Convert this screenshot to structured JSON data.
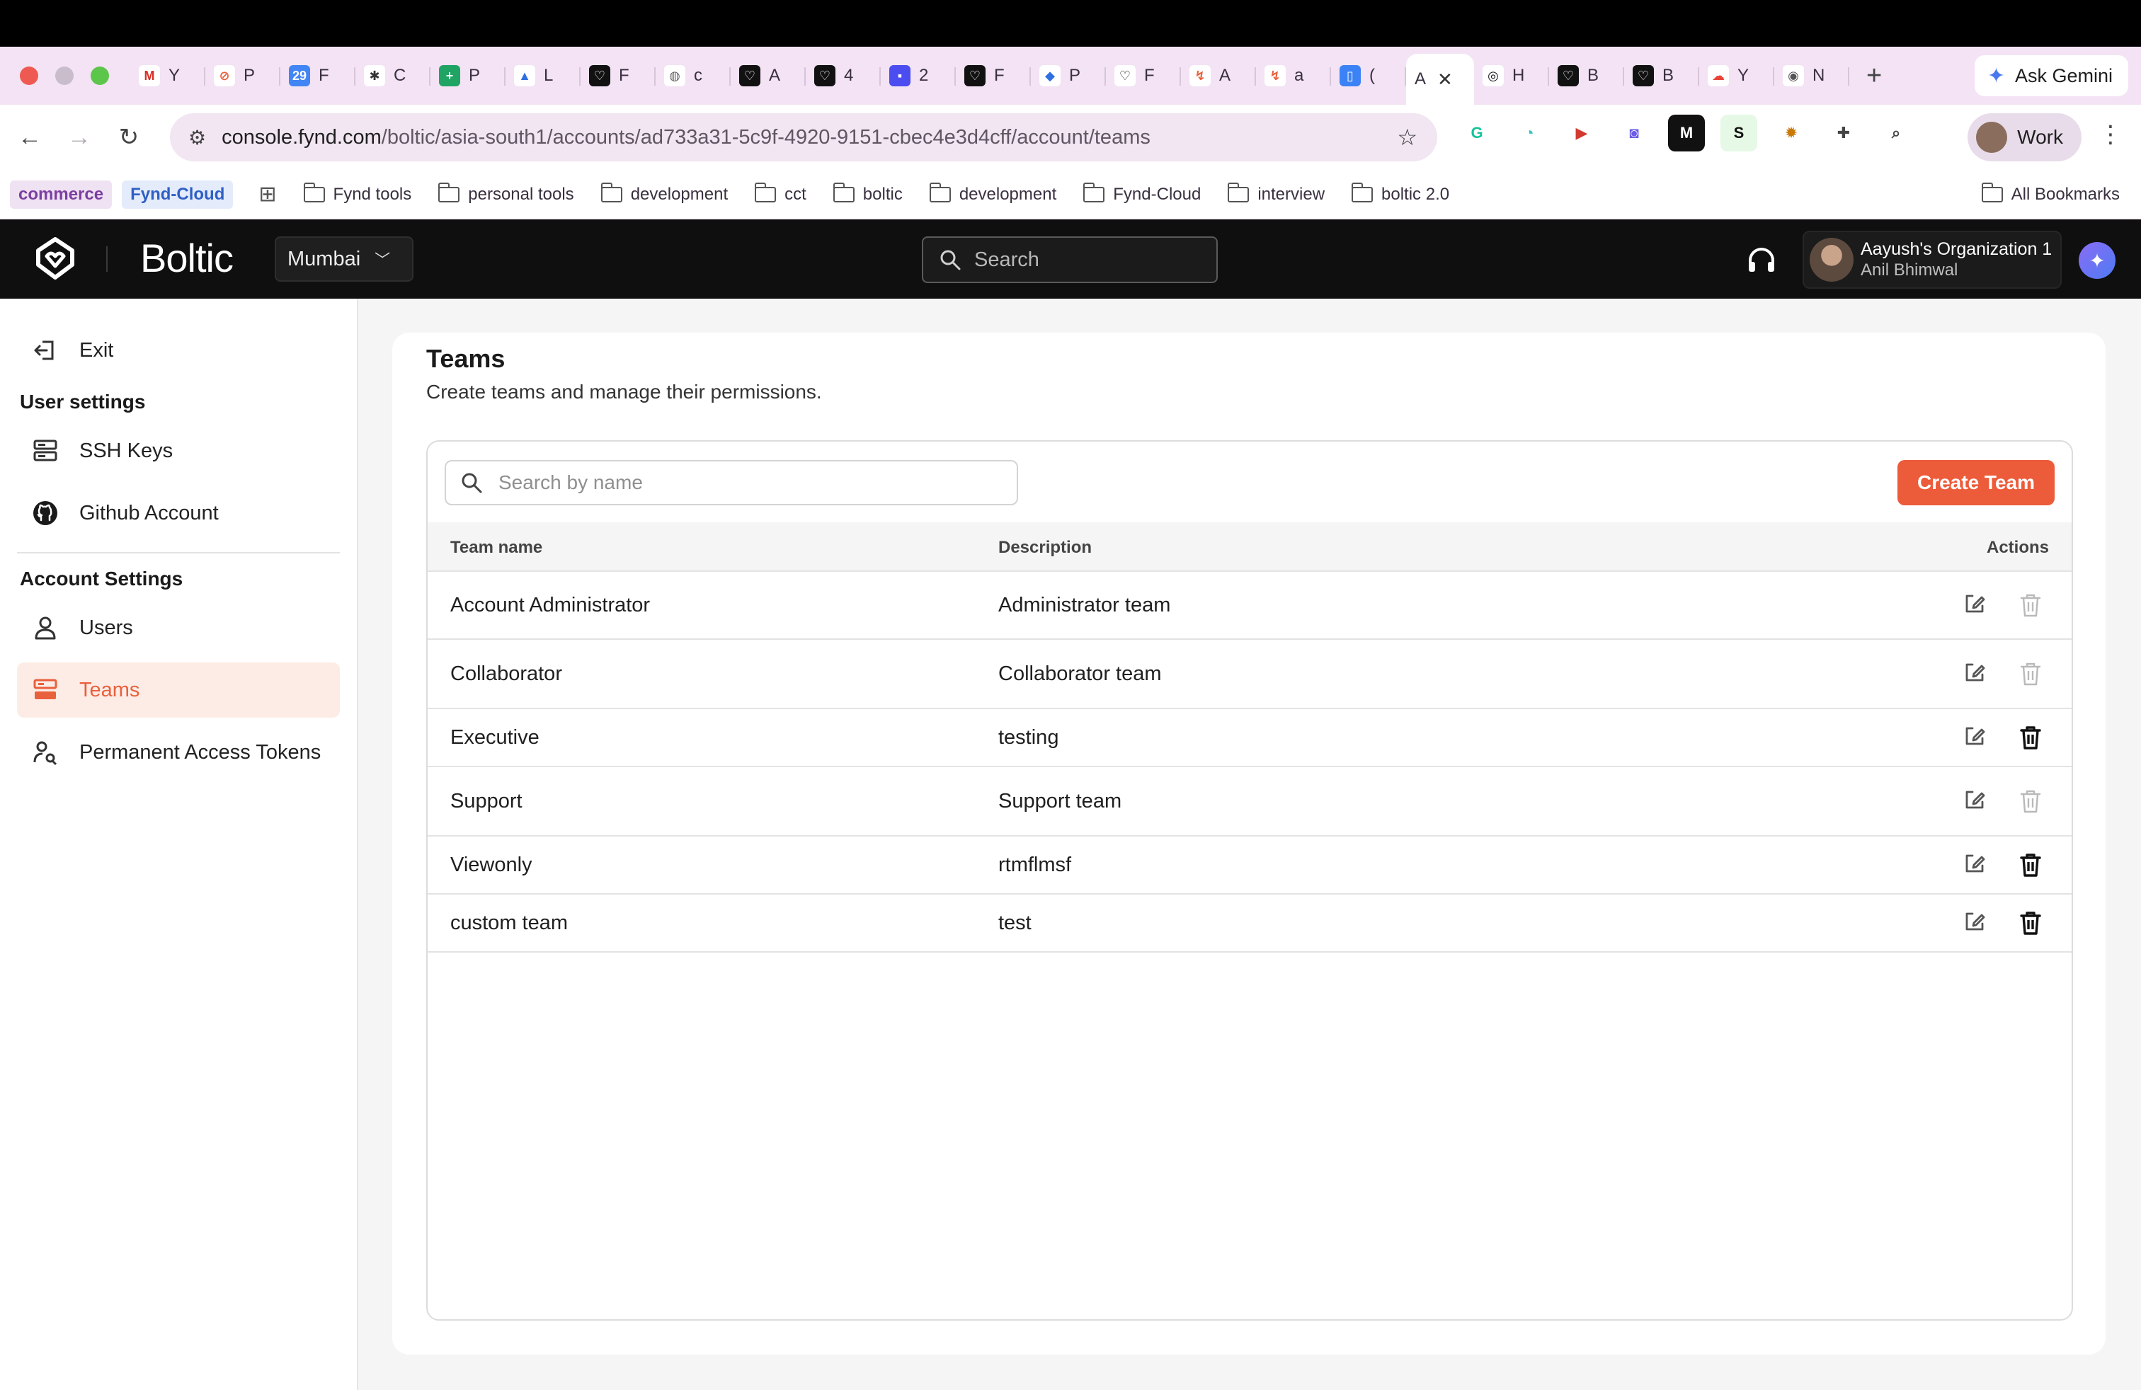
{
  "browser": {
    "tabs": [
      {
        "letter": "Y",
        "icon": "gmail-icon",
        "color": "#ffffff",
        "glyph": "M",
        "glyph_color": "#d93025"
      },
      {
        "letter": "P",
        "icon": "compass-icon",
        "color": "#ffffff",
        "glyph": "⊘",
        "glyph_color": "#e8603c"
      },
      {
        "letter": "F",
        "icon": "calendar-icon",
        "color": "#4285f4",
        "glyph": "29",
        "glyph_color": "#ffffff"
      },
      {
        "letter": "C",
        "icon": "openai-icon",
        "color": "#ffffff",
        "glyph": "✱",
        "glyph_color": "#333333"
      },
      {
        "letter": "P",
        "icon": "sheets-icon",
        "color": "#1fa463",
        "glyph": "+",
        "glyph_color": "#ffffff"
      },
      {
        "letter": "L",
        "icon": "atlassian-icon",
        "color": "#ffffff",
        "glyph": "▲",
        "glyph_color": "#2f6fe0"
      },
      {
        "letter": "F",
        "icon": "fynd-icon",
        "color": "#111111",
        "glyph": "♡",
        "glyph_color": "#ffffff"
      },
      {
        "letter": "c",
        "icon": "globe-icon",
        "color": "#ffffff",
        "glyph": "◍",
        "glyph_color": "#666666"
      },
      {
        "letter": "A",
        "icon": "fynd-icon",
        "color": "#111111",
        "glyph": "♡",
        "glyph_color": "#ffffff"
      },
      {
        "letter": "4",
        "icon": "fynd-icon",
        "color": "#111111",
        "glyph": "♡",
        "glyph_color": "#ffffff"
      },
      {
        "letter": "2",
        "icon": "linear-icon",
        "color": "#4b4df0",
        "glyph": "▪",
        "glyph_color": "#ffffff"
      },
      {
        "letter": "F",
        "icon": "fynd-icon",
        "color": "#111111",
        "glyph": "♡",
        "glyph_color": "#ffffff"
      },
      {
        "letter": "P",
        "icon": "azure-icon",
        "color": "#ffffff",
        "glyph": "◆",
        "glyph_color": "#2f6fe0"
      },
      {
        "letter": "F",
        "icon": "fynd-outline-icon",
        "color": "#ffffff",
        "glyph": "♡",
        "glyph_color": "#111111"
      },
      {
        "letter": "A",
        "icon": "boltic-icon",
        "color": "#ffffff",
        "glyph": "↯",
        "glyph_color": "#e8603c"
      },
      {
        "letter": "a",
        "icon": "boltic-icon",
        "color": "#ffffff",
        "glyph": "↯",
        "glyph_color": "#e8603c"
      },
      {
        "letter": "(",
        "icon": "docs-icon",
        "color": "#3b82f6",
        "glyph": "▯",
        "glyph_color": "#ffffff"
      }
    ],
    "active_tab": {
      "letter": "A"
    },
    "trailing_tabs": [
      {
        "letter": "H",
        "icon": "openai-icon",
        "color": "#ffffff",
        "glyph": "◎",
        "glyph_color": "#111111"
      },
      {
        "letter": "B",
        "icon": "fynd-icon",
        "color": "#111111",
        "glyph": "♡",
        "glyph_color": "#ffffff"
      },
      {
        "letter": "B",
        "icon": "fynd-icon",
        "color": "#111111",
        "glyph": "♡",
        "glyph_color": "#ffffff"
      },
      {
        "letter": "Y",
        "icon": "gcloud-icon",
        "color": "#ffffff",
        "glyph": "☁",
        "glyph_color": "#ea4335"
      },
      {
        "letter": "N",
        "icon": "chrome-icon",
        "color": "#ffffff",
        "glyph": "◉",
        "glyph_color": "#555555"
      }
    ],
    "new_tab": "+",
    "gemini_label": "Ask Gemini",
    "url_host": "console.fynd.com",
    "url_path": "/boltic/asia-south1/accounts/ad733a31-5c9f-4920-9151-cbec4e3d4cff/account/teams",
    "extensions": [
      {
        "icon": "grammarly-icon",
        "glyph": "G",
        "color": "#15c39a",
        "bg": "#ffffff"
      },
      {
        "icon": "timer-icon",
        "glyph": "◔",
        "color": "#36c2c2",
        "bg": "#ffffff"
      },
      {
        "icon": "forward-icon",
        "glyph": "▶",
        "color": "#d13b2f",
        "bg": "#ffffff"
      },
      {
        "icon": "screen-icon",
        "glyph": "◙",
        "color": "#6c5ce7",
        "bg": "#ffffff"
      },
      {
        "icon": "medium-icon",
        "glyph": "M",
        "color": "#ffffff",
        "bg": "#111111"
      },
      {
        "icon": "s-icon",
        "glyph": "S",
        "color": "#111111",
        "bg": "#e6f8e6"
      },
      {
        "icon": "bug-icon",
        "glyph": "✹",
        "color": "#c9790a",
        "bg": "#ffffff"
      },
      {
        "icon": "puzzle-icon",
        "glyph": "✚",
        "color": "#444444",
        "bg": "#ffffff"
      },
      {
        "icon": "lens-icon",
        "glyph": "⌕",
        "color": "#444444",
        "bg": "#ffffff"
      }
    ],
    "profile_label": "Work",
    "bookmarks": {
      "pill_commerce": "commerce",
      "pill_fynd": "Fynd-Cloud",
      "folders": [
        "Fynd tools",
        "personal tools",
        "development",
        "cct",
        "boltic",
        "development",
        "Fynd-Cloud",
        "interview",
        "boltic 2.0"
      ],
      "all": "All Bookmarks"
    }
  },
  "header": {
    "brand": "Boltic",
    "region": "Mumbai",
    "search_placeholder": "Search",
    "org_name": "Aayush's Organization 1",
    "user_name": "Anil Bhimwal",
    "ai_glyph": "✦"
  },
  "sidebar": {
    "exit": "Exit",
    "user_settings_heading": "User settings",
    "ssh_keys": "SSH Keys",
    "github": "Github Account",
    "account_settings_heading": "Account Settings",
    "users": "Users",
    "teams": "Teams",
    "tokens": "Permanent Access Tokens"
  },
  "page": {
    "title": "Teams",
    "subtitle": "Create teams and manage their permissions.",
    "search_placeholder": "Search by name",
    "create_button": "Create Team",
    "columns": {
      "name": "Team name",
      "description": "Description",
      "actions": "Actions"
    },
    "rows": [
      {
        "name": "Account Administrator",
        "description": "Administrator team",
        "delete_enabled": false
      },
      {
        "name": "Collaborator",
        "description": "Collaborator team",
        "delete_enabled": false
      },
      {
        "name": "Executive",
        "description": "testing",
        "delete_enabled": true
      },
      {
        "name": "Support",
        "description": "Support team",
        "delete_enabled": false
      },
      {
        "name": "Viewonly",
        "description": "rtmflmsf",
        "delete_enabled": true
      },
      {
        "name": "custom team",
        "description": "test",
        "delete_enabled": true
      }
    ]
  },
  "colors": {
    "accent": "#ec5b3a",
    "sidebar_active_bg": "#fdece6",
    "header_bg": "#0f0f0f",
    "delete_disabled": "#b9b9b9",
    "delete_enabled": "#111111"
  }
}
